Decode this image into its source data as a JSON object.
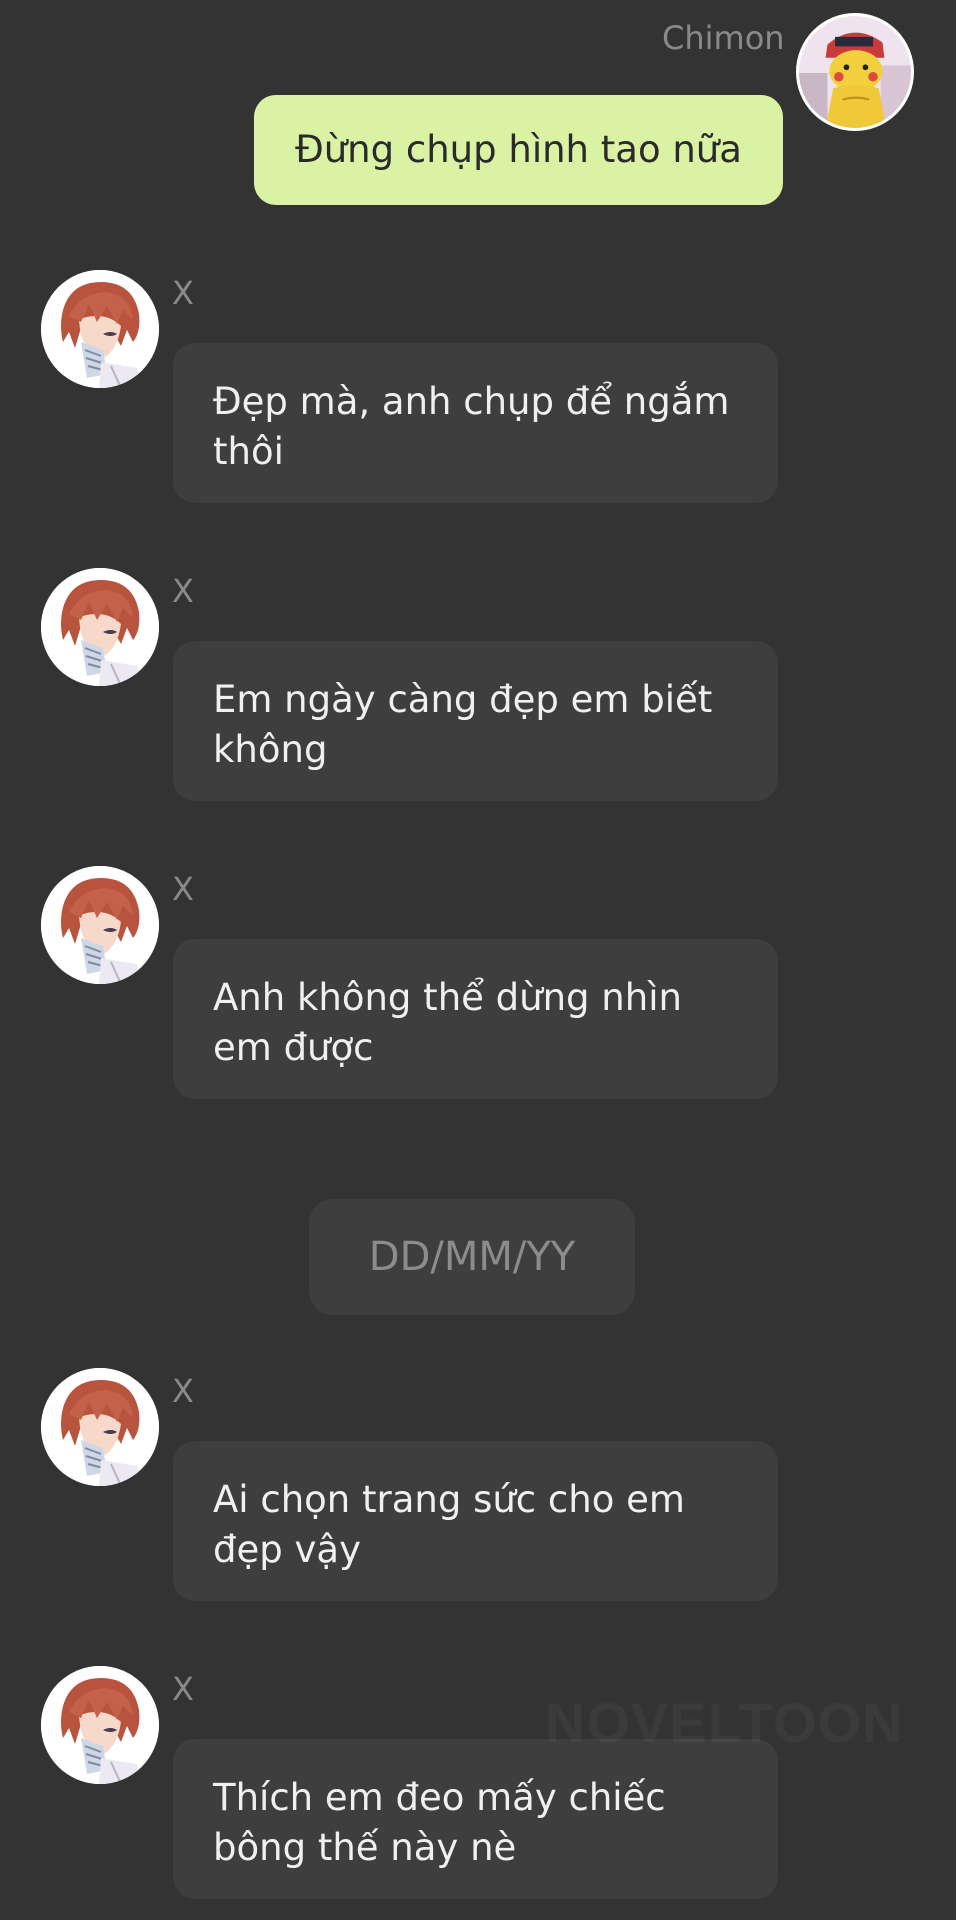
{
  "outgoing": {
    "sender_name": "Chimon",
    "avatar": "pikachu-avatar",
    "text": "Đừng chụp hình tao nữa"
  },
  "incoming_before_date": [
    {
      "sender_name": "X",
      "line1": "Đẹp mà, anh chụp để ngắm",
      "line2": "thôi"
    },
    {
      "sender_name": "X",
      "line1": "Em ngày càng đẹp em biết",
      "line2": "không"
    },
    {
      "sender_name": "X",
      "line1": "Anh không thể dừng nhìn",
      "line2": "em được"
    }
  ],
  "date_divider": "DD/MM/YY",
  "incoming_after_date": [
    {
      "sender_name": "X",
      "line1": "Ai chọn trang sức cho em",
      "line2": "đẹp vậy"
    },
    {
      "sender_name": "X",
      "line1": "Thích em đeo mấy chiếc",
      "line2": "bông thế này nè"
    }
  ],
  "watermark": "NOVELTOON",
  "colors": {
    "background": "#333333",
    "incoming_bubble": "#3e3e3e",
    "outgoing_bubble": "#d9f2a3",
    "name_text": "#8a8a8a"
  }
}
